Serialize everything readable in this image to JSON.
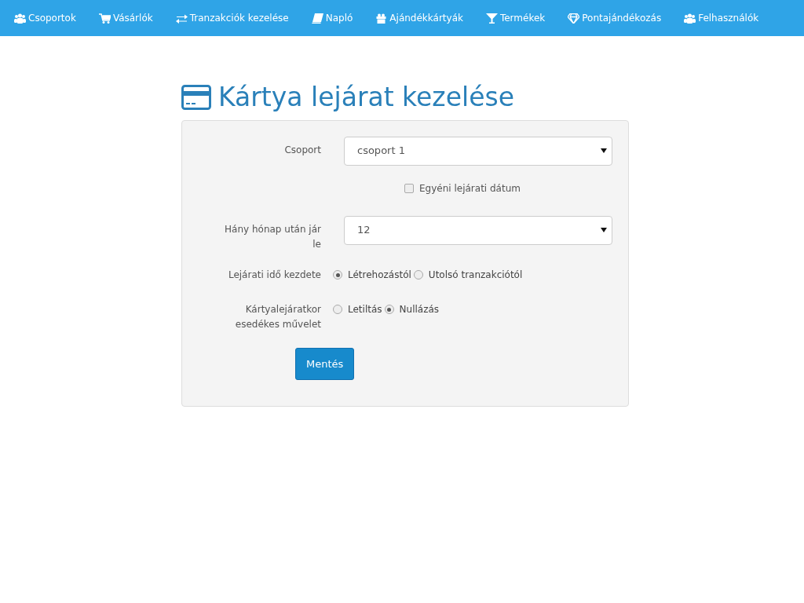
{
  "navbar": {
    "items": [
      {
        "label": "Csoportok",
        "kind": "users"
      },
      {
        "label": "Vásárlók",
        "kind": "cart"
      },
      {
        "label": "Tranzakciók kezelése",
        "kind": "exchange"
      },
      {
        "label": "Napló",
        "kind": "book"
      },
      {
        "label": "Ajándékkártyák",
        "kind": "gift"
      },
      {
        "label": "Termékek",
        "kind": "glass"
      },
      {
        "label": "Pontajándékozás",
        "kind": "diamond"
      },
      {
        "label": "Felhasználók",
        "kind": "users"
      }
    ]
  },
  "page_title": "Kártya lejárat kezelése",
  "form": {
    "rows": [
      {
        "kind": "select",
        "label": "Csoport",
        "value": "csoport 1"
      },
      {
        "kind": "checkbox",
        "option": "Egyéni lejárati dátum",
        "checked": false
      },
      {
        "kind": "select",
        "label": "Hány hónap után jár le",
        "value": "12"
      },
      {
        "kind": "radio",
        "label": "Lejárati idő kezdete",
        "options": [
          {
            "label": "Létrehozástól",
            "selected": true
          },
          {
            "label": "Utolsó tranzakciótól",
            "selected": false
          }
        ]
      },
      {
        "kind": "radio",
        "label": "Kártyalejáratkor esedékes művelet",
        "options": [
          {
            "label": "Letiltás",
            "selected": false
          },
          {
            "label": "Nullázás",
            "selected": true
          }
        ]
      }
    ],
    "submit": "Mentés"
  }
}
